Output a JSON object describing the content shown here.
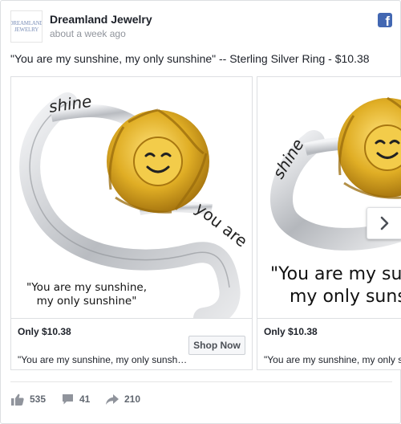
{
  "header": {
    "page_name": "Dreamland Jewelry",
    "timestamp": "about a week ago",
    "avatar_text": "DREAMLAND JEWELRY",
    "badge_icon": "facebook-icon"
  },
  "post": {
    "caption": "\"You are my sunshine, my only sunshine\" -- Sterling Silver Ring - $10.38"
  },
  "carousel": {
    "cards": [
      {
        "engraving_left": "shine",
        "engraving_right": "you are",
        "quote_line1": "\"You are my sunshine,",
        "quote_line2": "my only sunshine\"",
        "price": "Only $10.38",
        "description": "\"You are my sunshine, my only sunshine\"",
        "cta": "Shop Now"
      },
      {
        "engraving_left": "shine",
        "quote_line1": "\"You are my sunshine,",
        "quote_line2": "my only sunshine\"",
        "price": "Only $10.38",
        "description": "\"You are my sunshine, my only sunshine\""
      }
    ],
    "next_icon": "chevron-right-icon"
  },
  "stats": {
    "likes": "535",
    "comments": "41",
    "shares": "210"
  },
  "colors": {
    "brand_blue": "#4267b2",
    "gold": "#d9a820",
    "silver": "#c9cbcf"
  }
}
